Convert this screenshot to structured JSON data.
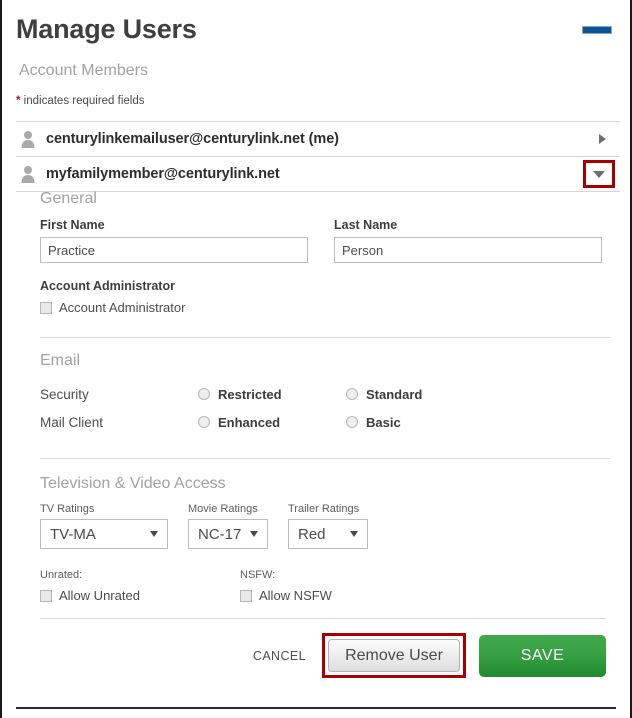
{
  "header": {
    "title": "Manage Users",
    "minimize_icon": "minimize-dash-icon",
    "minimize_color": "#0b5394"
  },
  "account_members": {
    "heading": "Account Members",
    "required_note_star": "*",
    "required_note": " indicates required fields",
    "users": [
      {
        "email": "centurylinkemailuser@centurylink.net (me)",
        "icon": "person-icon",
        "state_icon": "chevron-right-icon",
        "expanded": false,
        "highlighted": false
      },
      {
        "email": "myfamilymember@centurylink.net",
        "icon": "person-icon",
        "state_icon": "chevron-down-icon",
        "expanded": true,
        "highlighted": true
      }
    ]
  },
  "general": {
    "heading": "General",
    "first_name_label": "First Name",
    "first_name_value": "Practice",
    "first_name_placeholder": "First Name",
    "last_name_label": "Last Name",
    "last_name_value": "Person",
    "last_name_placeholder": "Last Name",
    "admin_heading": "Account Administrator",
    "admin_checkbox_label": "Account Administrator",
    "admin_checked": false
  },
  "email": {
    "heading": "Email",
    "security_label": "Security",
    "security_options": [
      "Restricted",
      "Standard"
    ],
    "security_selected": "",
    "mail_client_label": "Mail Client",
    "mail_client_options": [
      "Enhanced",
      "Basic"
    ],
    "mail_client_selected": ""
  },
  "television": {
    "heading": "Television & Video Access",
    "tv_ratings_label": "TV Ratings",
    "tv_ratings_value": "TV-MA",
    "movie_ratings_label": "Movie Ratings",
    "movie_ratings_value": "NC-17",
    "trailer_ratings_label": "Trailer Ratings",
    "trailer_ratings_value": "Red",
    "unrated_label": "Unrated:",
    "unrated_checkbox_label": "Allow Unrated",
    "unrated_checked": false,
    "nsfw_label": "NSFW:",
    "nsfw_checkbox_label": "Allow NSFW",
    "nsfw_checked": false
  },
  "footer": {
    "cancel_label": "CANCEL",
    "remove_label": "Remove User",
    "save_label": "SAVE",
    "save_color": "#2f9c3c",
    "highlight_color": "#a80000"
  }
}
